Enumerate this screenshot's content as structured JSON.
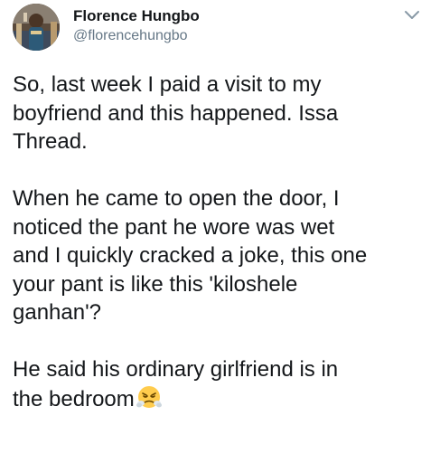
{
  "tweet": {
    "author_name": "Florence Hungbo",
    "author_handle": "@florencehungbo",
    "paragraphs": [
      [
        "So, last week I paid a visit to my",
        "boyfriend and this happened. Issa",
        "Thread."
      ],
      [
        "When he came to open the door, I",
        "noticed the pant he wore was wet",
        "and I quickly cracked a joke, this one",
        "your pant is like this 'kiloshele",
        "ganhan'?"
      ],
      [
        "He said his ordinary girlfriend is in",
        "the bedroom"
      ]
    ],
    "trailing_emoji": "face-with-steam-from-nose"
  },
  "icons": {
    "menu": "chevron-down-icon",
    "avatar": "profile-photo"
  },
  "colors": {
    "text": "#14171a",
    "secondary_text": "#657786",
    "caret": "#8899a6",
    "background": "#ffffff",
    "emoji_face": "#ffcc4d"
  }
}
